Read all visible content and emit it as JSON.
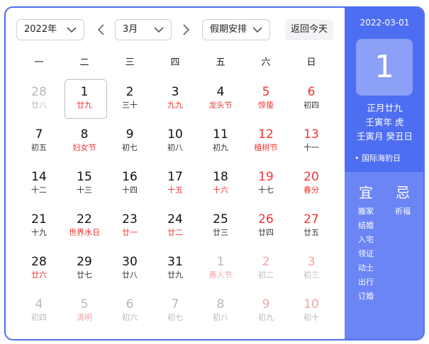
{
  "toolbar": {
    "year": "2022年",
    "month": "3月",
    "holiday": "假期安排",
    "today": "返回今天"
  },
  "weekdays": [
    "一",
    "二",
    "三",
    "四",
    "五",
    "六",
    "日"
  ],
  "days": [
    {
      "d": "28",
      "l": "廿八",
      "dim": true
    },
    {
      "d": "1",
      "l": "廿九",
      "lr": true,
      "selected": true
    },
    {
      "d": "2",
      "l": "三十"
    },
    {
      "d": "3",
      "l": "九九",
      "lr": true
    },
    {
      "d": "4",
      "l": "龙头节",
      "lr": true
    },
    {
      "d": "5",
      "l": "惊蛰",
      "red": true
    },
    {
      "d": "6",
      "l": "初四",
      "nr": true
    },
    {
      "d": "7",
      "l": "初五"
    },
    {
      "d": "8",
      "l": "妇女节",
      "lr": true
    },
    {
      "d": "9",
      "l": "初七"
    },
    {
      "d": "10",
      "l": "初八"
    },
    {
      "d": "11",
      "l": "初九"
    },
    {
      "d": "12",
      "l": "植树节",
      "red": true
    },
    {
      "d": "13",
      "l": "十一",
      "nr": true
    },
    {
      "d": "14",
      "l": "十二"
    },
    {
      "d": "15",
      "l": "十三"
    },
    {
      "d": "16",
      "l": "十四"
    },
    {
      "d": "17",
      "l": "十五",
      "lr": true
    },
    {
      "d": "18",
      "l": "十六",
      "lr": true
    },
    {
      "d": "19",
      "l": "十七",
      "nr": true
    },
    {
      "d": "20",
      "l": "春分",
      "red": true
    },
    {
      "d": "21",
      "l": "十九"
    },
    {
      "d": "22",
      "l": "世界水日",
      "lr": true
    },
    {
      "d": "23",
      "l": "廿一",
      "lr": true
    },
    {
      "d": "24",
      "l": "廿二",
      "lr": true
    },
    {
      "d": "25",
      "l": "廿三"
    },
    {
      "d": "26",
      "l": "廿四",
      "nr": true
    },
    {
      "d": "27",
      "l": "廿五",
      "nr": true
    },
    {
      "d": "28",
      "l": "廿六",
      "lr": true
    },
    {
      "d": "29",
      "l": "廿七"
    },
    {
      "d": "30",
      "l": "廿八"
    },
    {
      "d": "31",
      "l": "廿九"
    },
    {
      "d": "1",
      "l": "愚人节",
      "dim": true,
      "ldr": true
    },
    {
      "d": "2",
      "l": "初二",
      "dim": true,
      "red": true,
      "nlgray": true
    },
    {
      "d": "3",
      "l": "初三",
      "dim": true,
      "red": true,
      "nlgray": true
    },
    {
      "d": "4",
      "l": "初四",
      "dim": true
    },
    {
      "d": "5",
      "l": "清明",
      "dim": true,
      "ldr": true
    },
    {
      "d": "6",
      "l": "初六",
      "dim": true
    },
    {
      "d": "7",
      "l": "初七",
      "dim": true
    },
    {
      "d": "8",
      "l": "初八",
      "dim": true
    },
    {
      "d": "9",
      "l": "初九",
      "dim": true,
      "red": true,
      "nlgray": true
    },
    {
      "d": "10",
      "l": "初十",
      "dim": true,
      "red": true,
      "nlgray": true
    }
  ],
  "side": {
    "date": "2022-03-01",
    "big_day": "1",
    "lunar_date": "正月廿九",
    "year_gz": "壬寅年 虎",
    "month_day_gz": "壬寅月 癸丑日",
    "festival": "国际海豹日",
    "yi_label": "宜",
    "ji_label": "忌",
    "yi": [
      "搬家",
      "结婚",
      "入宅",
      "领证",
      "动土",
      "出行",
      "订婚"
    ],
    "ji": [
      "祈福"
    ]
  },
  "colors": {
    "accent": "#4e6ef2",
    "side_panel": "#6b85f5",
    "holiday_red": "#f73131"
  }
}
